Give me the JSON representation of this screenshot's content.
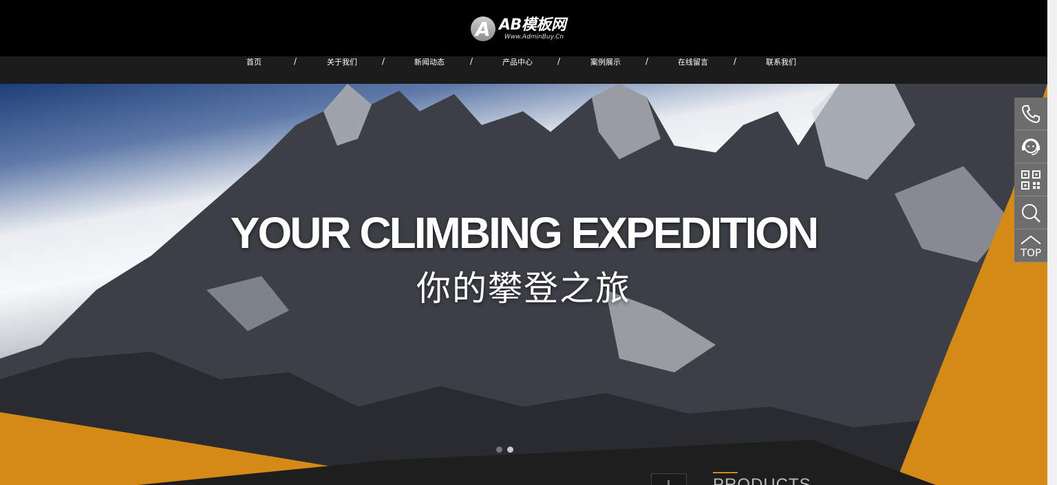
{
  "brand": {
    "name": "AB模板网",
    "url": "Www.AdminBuy.Cn",
    "badge_letter": "A"
  },
  "nav": {
    "items": [
      {
        "label": "首页"
      },
      {
        "label": "关于我们"
      },
      {
        "label": "新闻动态"
      },
      {
        "label": "产品中心"
      },
      {
        "label": "案例展示"
      },
      {
        "label": "在线留言"
      },
      {
        "label": "联系我们"
      }
    ],
    "separator": "/"
  },
  "hero": {
    "title": "YOUR CLIMBING EXPEDITION",
    "subtitle": "你的攀登之旅",
    "slides_total": 2,
    "slide_active": 1
  },
  "section": {
    "heading": "PRODUCTS"
  },
  "sidebar": {
    "buttons": [
      {
        "icon": "phone-icon"
      },
      {
        "icon": "customer-service-icon"
      },
      {
        "icon": "qr-code-icon"
      },
      {
        "icon": "search-icon"
      },
      {
        "icon": "back-to-top-icon",
        "label": "TOP"
      }
    ]
  },
  "colors": {
    "accent": "#D48A14",
    "header_bg": "#000000",
    "nav_bg": "#1B1B1B",
    "sidebar_bg": "#6D6D6D"
  }
}
